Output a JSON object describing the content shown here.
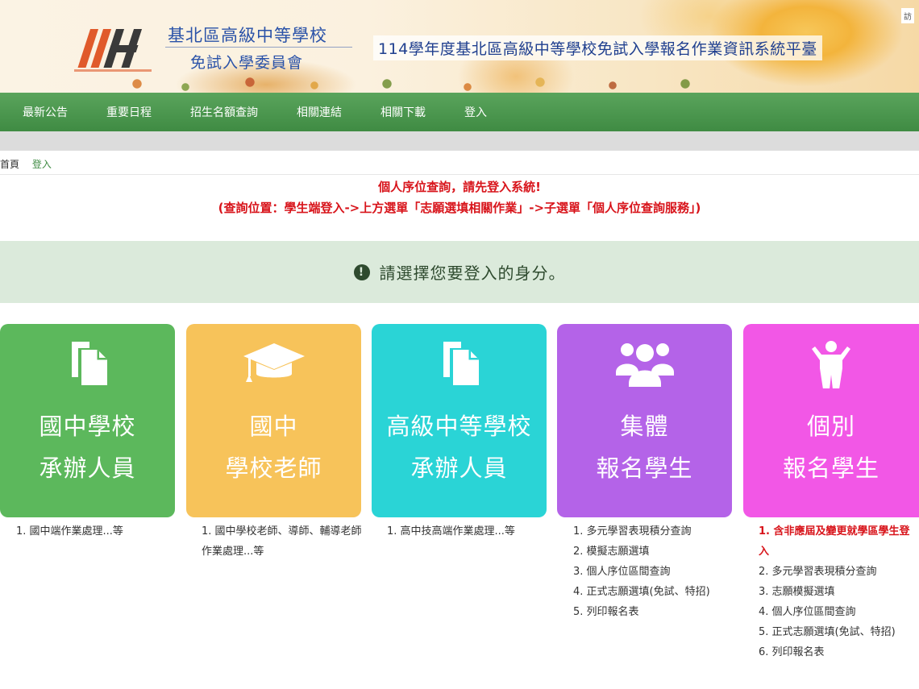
{
  "header": {
    "logo_text": "114",
    "org_name_line1": "基北區高級中等學校",
    "org_name_line2": "免試入學委員會",
    "system_title": "114學年度基北區高級中等學校免試入學報名作業資訊系統平臺",
    "corner_text": "訪"
  },
  "nav": {
    "items": [
      "最新公告",
      "重要日程",
      "招生名額查詢",
      "相關連結",
      "相關下載",
      "登入"
    ]
  },
  "breadcrumb": {
    "home": "首頁",
    "current": "登入"
  },
  "notice": {
    "line1": "個人序位查詢，請先登入系統!",
    "line2": "(查詢位置：學生端登入->上方選單「志願選填相關作業」->子選單「個人序位查詢服務」)"
  },
  "prompt": {
    "icon": "exclamation-circle-icon",
    "text": "請選擇您要登入的身分。"
  },
  "cards": [
    {
      "icon": "document-copy-icon",
      "line1": "國中學校",
      "line2": "承辦人員",
      "color": "#5cb85c",
      "desc": [
        "1. 國中端作業處理...等"
      ]
    },
    {
      "icon": "graduation-cap-icon",
      "line1": "國中",
      "line2": "學校老師",
      "color": "#f7c35a",
      "desc": [
        "1. 國中學校老師、導師、輔導老師作業處理...等"
      ]
    },
    {
      "icon": "document-copy-icon",
      "line1": "高級中等學校",
      "line2": "承辦人員",
      "color": "#2ad4d6",
      "desc": [
        "1. 高中技高端作業處理...等"
      ]
    },
    {
      "icon": "group-users-icon",
      "line1": "集體",
      "line2": "報名學生",
      "color": "#b463e8",
      "desc": [
        "1. 多元學習表現積分查詢",
        "2. 模擬志願選填",
        "3. 個人序位區間查詢",
        "4. 正式志願選填(免試、特招)",
        "5. 列印報名表"
      ]
    },
    {
      "icon": "single-user-icon",
      "line1": "個別",
      "line2": "報名學生",
      "color": "#f257e6",
      "desc_highlight": "1. 含非應屆及變更就學區學生登入",
      "desc": [
        "2. 多元學習表現積分查詢",
        "3. 志願模擬選填",
        "4. 個人序位區間查詢",
        "5. 正式志願選填(免試、特招)",
        "6. 列印報名表"
      ]
    }
  ]
}
